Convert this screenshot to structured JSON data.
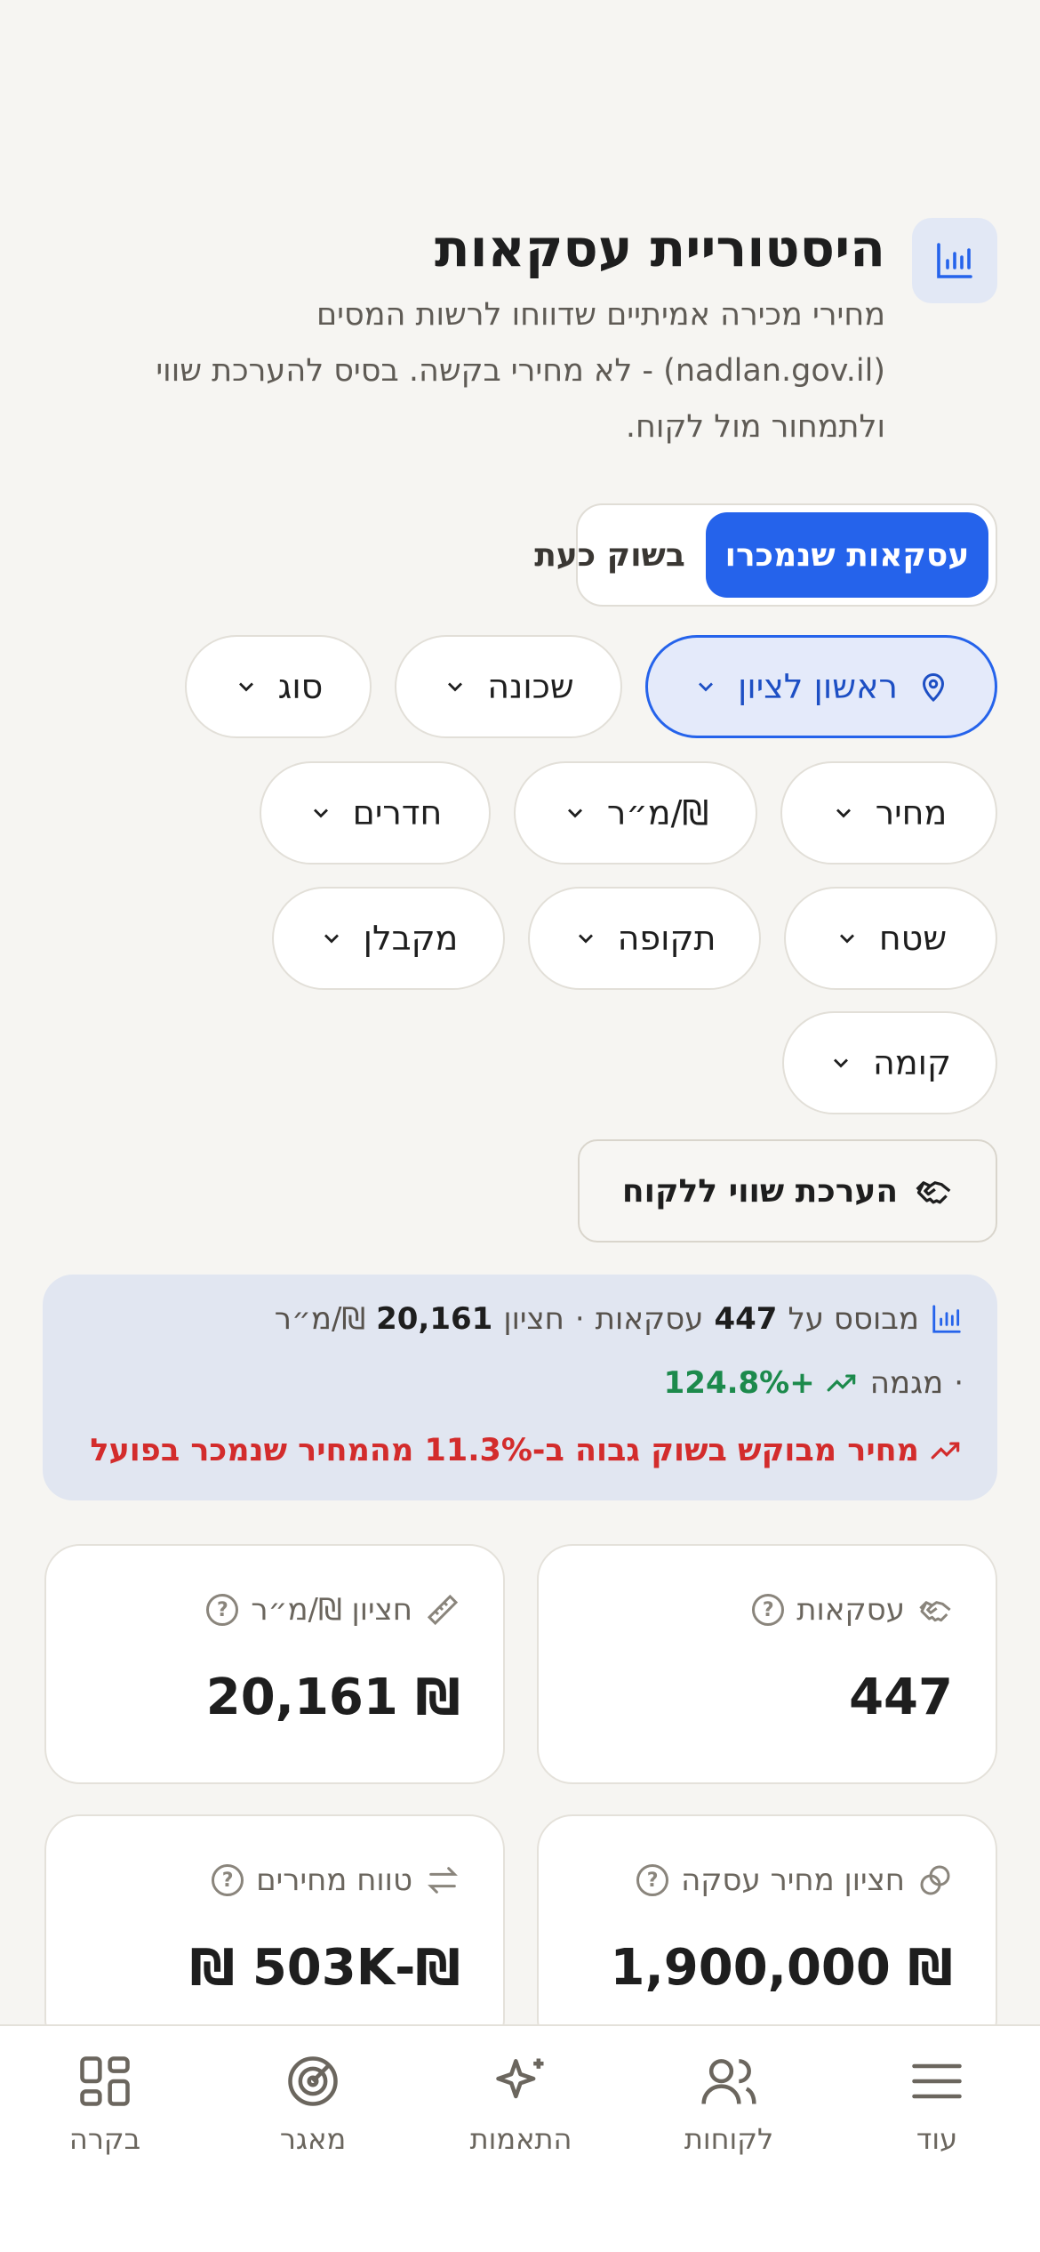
{
  "header": {
    "title": "היסטוריית עסקאות",
    "subtitle": "מחירי מכירה אמיתיים שדווחו לרשות המסים (nadlan.gov.il) - לא מחירי בקשה. בסיס להערכת שווי ולתמחור מול לקוח.",
    "icon": "bar-chart-icon"
  },
  "toggle": {
    "active_label": "עסקאות שנמכרו",
    "inactive_label": "בשוק כעת"
  },
  "filters": {
    "location": "ראשון לציון",
    "neighborhood": "שכונה",
    "type": "סוג",
    "price": "מחיר",
    "price_per_sqm": "₪/מ״ר",
    "rooms": "חדרים",
    "area": "שטח",
    "period": "תקופה",
    "contractor": "מקבלן",
    "floor": "קומה"
  },
  "valuation_button": {
    "label": "הערכת שווי ללקוח",
    "icon": "handshake-icon"
  },
  "banner": {
    "based_on_prefix": "מבוסס על",
    "deals_count": "447",
    "deals_word": "עסקאות",
    "separator": "·",
    "median_word": "חציון",
    "median_value": "20,161",
    "median_unit": "₪/מ״ר",
    "trend_word": "מגמה",
    "trend_value": "+124.8%",
    "warning": "מחיר מבוקש בשוק גבוה ב-11.3% מהמחיר שנמכר בפועל"
  },
  "cards": [
    {
      "label": "עסקאות",
      "value": "447",
      "icon": "handshake-icon"
    },
    {
      "label": "חציון ₪/מ״ר",
      "value": "₪ 20,161",
      "icon": "ruler-icon"
    },
    {
      "label": "חציון מחיר עסקה",
      "value": "₪ 1,900,000",
      "icon": "coins-icon"
    },
    {
      "label": "טווח מחירים",
      "value": "₪-503K ₪",
      "icon": "arrows-swap-icon"
    }
  ],
  "nav": [
    {
      "label": "בקרה",
      "icon": "dashboard-icon"
    },
    {
      "label": "מאגר",
      "icon": "radar-icon"
    },
    {
      "label": "התאמות",
      "icon": "sparkles-icon"
    },
    {
      "label": "לקוחות",
      "icon": "users-icon"
    },
    {
      "label": "עוד",
      "icon": "menu-icon"
    }
  ],
  "colors": {
    "accent": "#2563eb",
    "background": "#f6f5f2",
    "banner": "#e1e6f1",
    "positive": "#1c8a4c",
    "negative": "#d32c2c"
  }
}
